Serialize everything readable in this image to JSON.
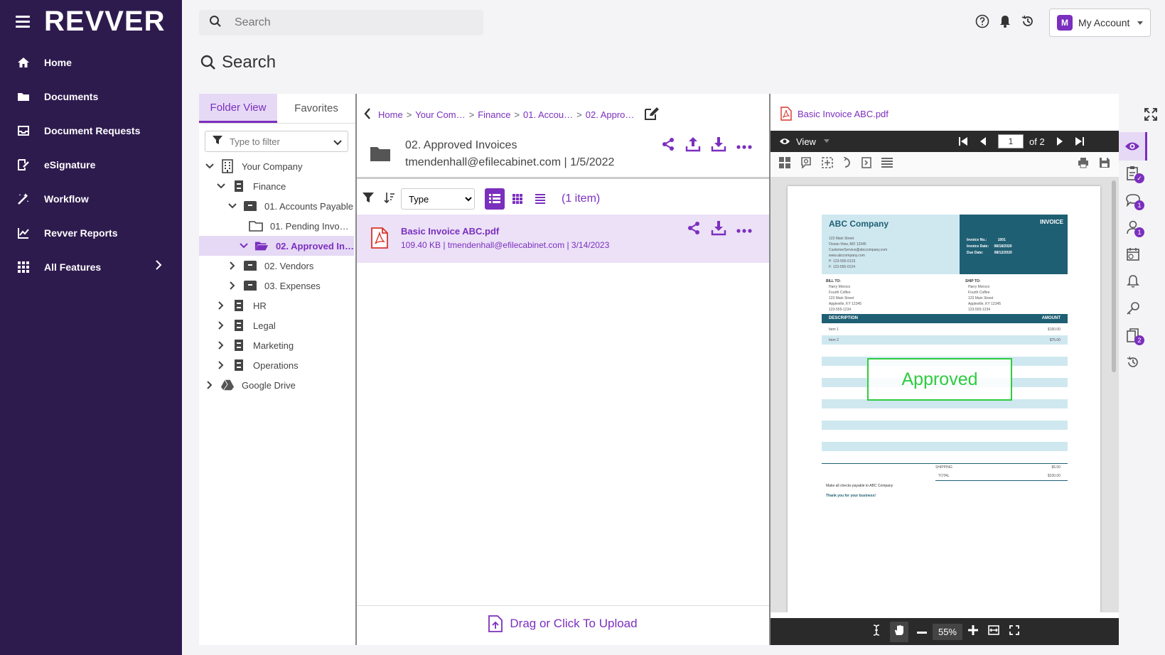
{
  "app": {
    "logo": "REVVER"
  },
  "sidebar": {
    "items": [
      {
        "label": "Home",
        "icon": "home-icon"
      },
      {
        "label": "Documents",
        "icon": "folder-icon"
      },
      {
        "label": "Document Requests",
        "icon": "inbox-icon"
      },
      {
        "label": "eSignature",
        "icon": "signature-icon"
      },
      {
        "label": "Workflow",
        "icon": "workflow-icon"
      },
      {
        "label": "Revver Reports",
        "icon": "chart-icon"
      },
      {
        "label": "All Features",
        "icon": "grid-icon"
      }
    ]
  },
  "topbar": {
    "search_placeholder": "Search",
    "account_badge": "M",
    "account_label": "My Account"
  },
  "page": {
    "title": "Search"
  },
  "tree": {
    "tabs": [
      "Folder View",
      "Favorites"
    ],
    "filter_placeholder": "Type to filter",
    "nodes": [
      "Your Company",
      "Finance",
      "01. Accounts Payable",
      "01. Pending Invo…",
      "02. Approved In…",
      "02. Vendors",
      "03. Expenses",
      "HR",
      "Legal",
      "Marketing",
      "Operations",
      "Google Drive"
    ]
  },
  "breadcrumb": [
    "Home",
    "Your Com…",
    "Finance",
    "01. Accou…",
    "02. Appro…"
  ],
  "folder": {
    "name": "02. Approved Invoices",
    "meta": "tmendenhall@efilecabinet.com | 1/5/2022"
  },
  "listing": {
    "type_select": "Type",
    "item_count": "(1 item)",
    "file": {
      "name": "Basic Invoice ABC.pdf",
      "meta": "109.40 KB | tmendenhall@efilecabinet.com | 3/14/2023"
    },
    "upload_label": "Drag or Click To Upload"
  },
  "viewer": {
    "title": "Basic Invoice ABC.pdf",
    "view_label": "View",
    "page_current": "1",
    "page_total": "of 2",
    "zoom": "55%"
  },
  "rail_badges": {
    "comments": "1",
    "users": "1",
    "versions": "2"
  },
  "invoice": {
    "company": "ABC Company",
    "title": "INVOICE",
    "address_lines": [
      "123 Main Street",
      "Ocean View, MO 12345",
      "CustomerService@abccompany.com",
      "www.abccompany.com",
      "P: 123-555-0123",
      "F: 123-555-0124"
    ],
    "invoice_no_label": "Invoice No.:",
    "invoice_no": "1001",
    "invoice_date_label": "Invoice Date:",
    "invoice_date": "08/18/2020",
    "due_date_label": "Due Date:",
    "due_date": "08/12/2020",
    "bill_to_label": "BILL TO:",
    "bill_to": [
      "Harry Moroco",
      "Fourth Coffee",
      "123 Main Street",
      "Appleville, KY 12345",
      "123-555-1234"
    ],
    "ship_to_label": "SHIP TO:",
    "ship_to": [
      "Harry Moroco",
      "Fourth Coffee",
      "123 Main Street",
      "Appleville, KY 12345",
      "123-555-1234"
    ],
    "desc_header": "DESCRIPTION",
    "amount_header": "AMOUNT",
    "items": [
      {
        "desc": "Item 1",
        "amount": "$150.00"
      },
      {
        "desc": "Item 2",
        "amount": "$75.00"
      }
    ],
    "stamp": "Approved",
    "shipping_label": "SHIPPING",
    "shipping": "$5.00",
    "total_label": "TOTAL",
    "total": "$230.00",
    "note": "Make all checks payable to ABC Company",
    "thanks": "Thank you for your business!"
  },
  "colors": {
    "brand": "#7b2fbe",
    "sidebar_bg": "#2e1b4e",
    "selected_bg": "#e6d9f5",
    "invoice_teal": "#1f5f73",
    "stamp_green": "#2ecc40"
  }
}
